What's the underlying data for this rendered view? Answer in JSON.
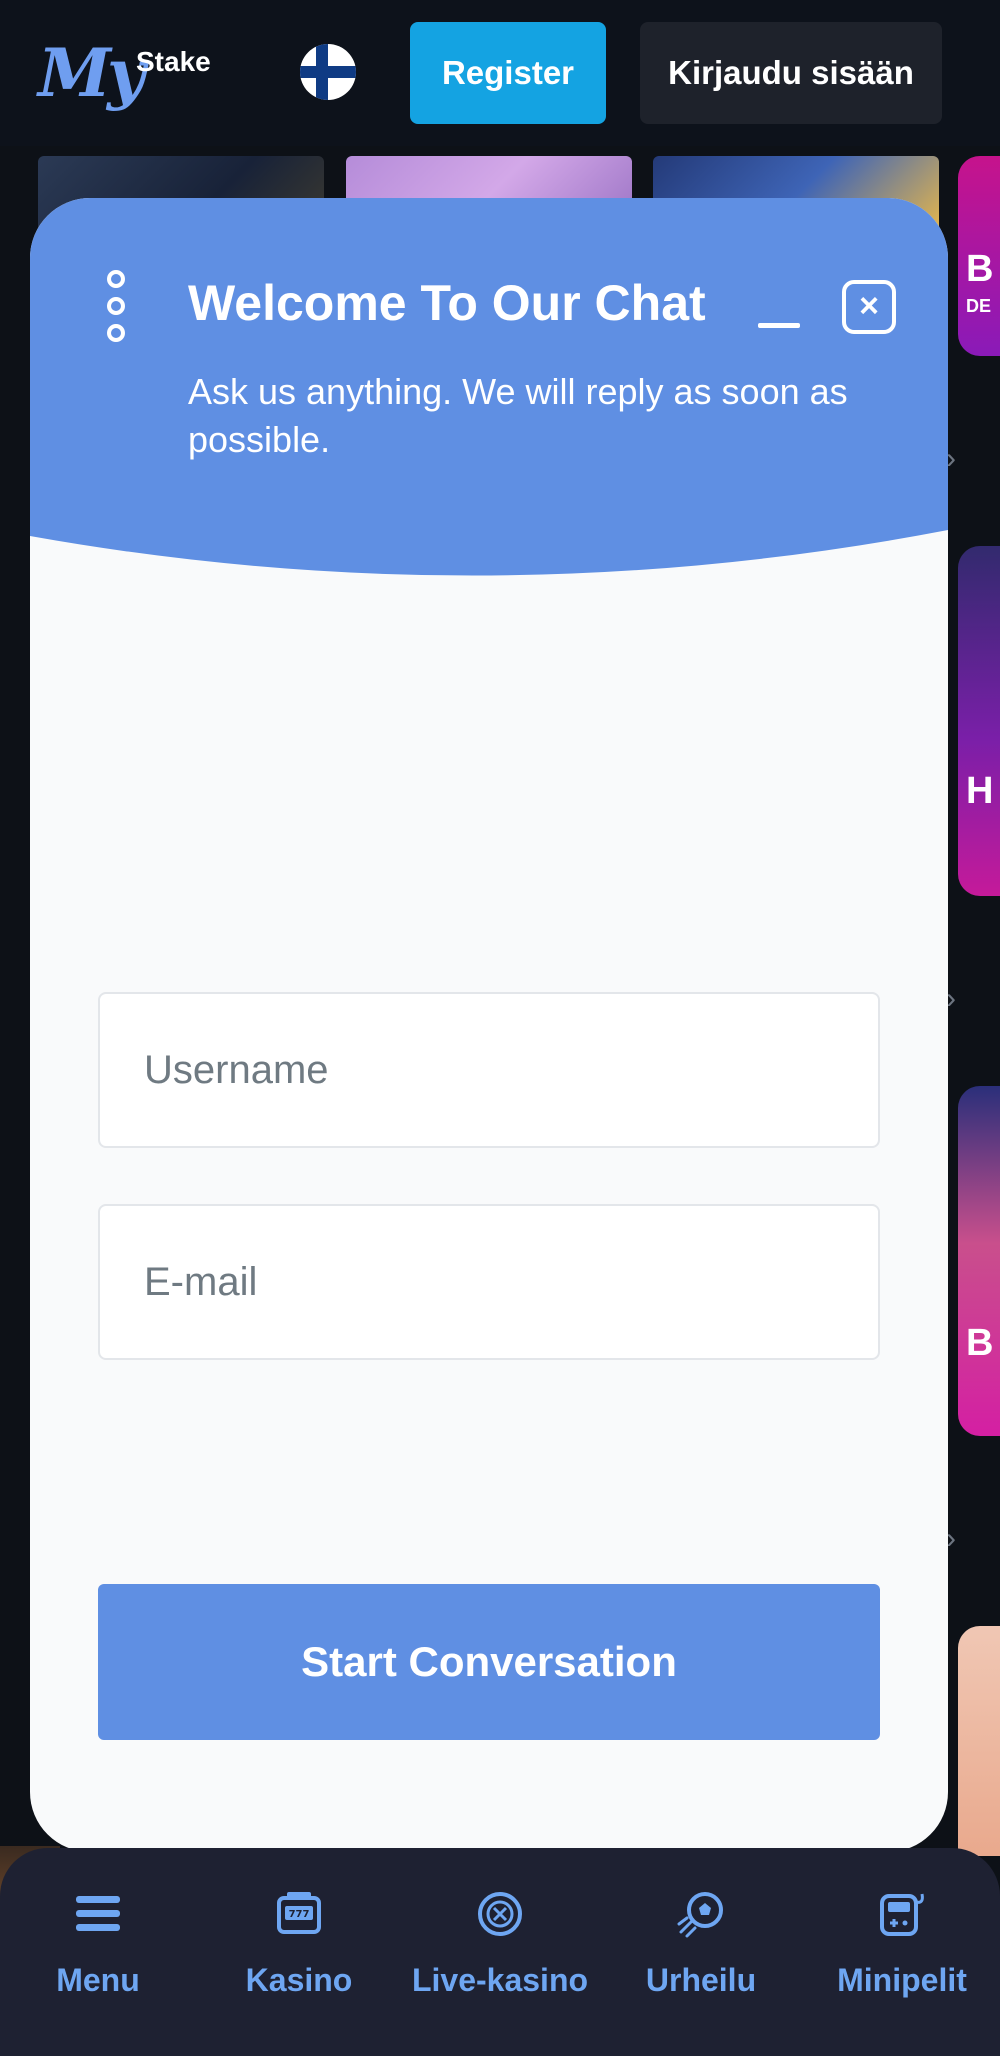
{
  "header": {
    "logo_main": "My",
    "logo_sub": "Stake",
    "register_label": "Register",
    "login_label": "Kirjaudu sisään"
  },
  "background": {
    "side_cards": [
      {
        "text": "B",
        "sub": "DE"
      },
      {
        "text": "H",
        "sub": ""
      },
      {
        "text": "B",
        "sub": ""
      }
    ]
  },
  "chat": {
    "title": "Welcome To Our Chat",
    "subtitle": "Ask us anything. We will reply as soon as possible.",
    "username_placeholder": "Username",
    "email_placeholder": "E-mail",
    "start_label": "Start Conversation",
    "colors": {
      "header": "#5f8fe3",
      "button": "#5f8fe3"
    }
  },
  "bottom_nav": {
    "items": [
      {
        "label": "Menu",
        "icon": "menu-icon"
      },
      {
        "label": "Kasino",
        "icon": "slot-machine-icon"
      },
      {
        "label": "Live-kasino",
        "icon": "roulette-chip-icon"
      },
      {
        "label": "Urheilu",
        "icon": "soccer-ball-icon"
      },
      {
        "label": "Minipelit",
        "icon": "minigame-icon"
      }
    ],
    "accent_color": "#6ea6f2"
  }
}
